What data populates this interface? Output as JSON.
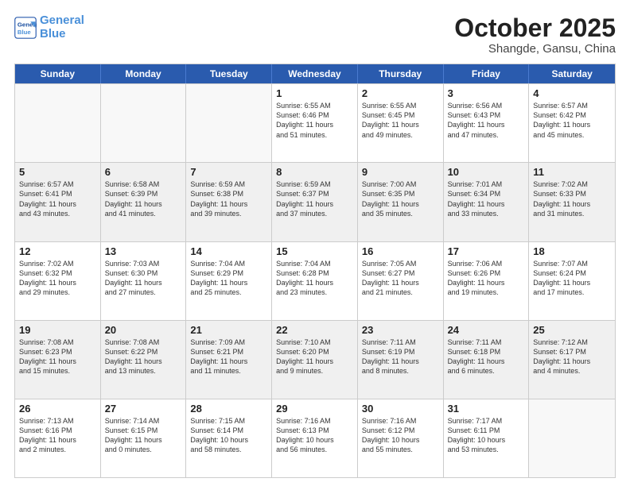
{
  "header": {
    "logo_line1": "General",
    "logo_line2": "Blue",
    "month": "October 2025",
    "location": "Shangde, Gansu, China"
  },
  "weekdays": [
    "Sunday",
    "Monday",
    "Tuesday",
    "Wednesday",
    "Thursday",
    "Friday",
    "Saturday"
  ],
  "rows": [
    [
      {
        "num": "",
        "lines": [],
        "empty": true
      },
      {
        "num": "",
        "lines": [],
        "empty": true
      },
      {
        "num": "",
        "lines": [],
        "empty": true
      },
      {
        "num": "1",
        "lines": [
          "Sunrise: 6:55 AM",
          "Sunset: 6:46 PM",
          "Daylight: 11 hours",
          "and 51 minutes."
        ],
        "empty": false
      },
      {
        "num": "2",
        "lines": [
          "Sunrise: 6:55 AM",
          "Sunset: 6:45 PM",
          "Daylight: 11 hours",
          "and 49 minutes."
        ],
        "empty": false
      },
      {
        "num": "3",
        "lines": [
          "Sunrise: 6:56 AM",
          "Sunset: 6:43 PM",
          "Daylight: 11 hours",
          "and 47 minutes."
        ],
        "empty": false
      },
      {
        "num": "4",
        "lines": [
          "Sunrise: 6:57 AM",
          "Sunset: 6:42 PM",
          "Daylight: 11 hours",
          "and 45 minutes."
        ],
        "empty": false
      }
    ],
    [
      {
        "num": "5",
        "lines": [
          "Sunrise: 6:57 AM",
          "Sunset: 6:41 PM",
          "Daylight: 11 hours",
          "and 43 minutes."
        ],
        "empty": false
      },
      {
        "num": "6",
        "lines": [
          "Sunrise: 6:58 AM",
          "Sunset: 6:39 PM",
          "Daylight: 11 hours",
          "and 41 minutes."
        ],
        "empty": false
      },
      {
        "num": "7",
        "lines": [
          "Sunrise: 6:59 AM",
          "Sunset: 6:38 PM",
          "Daylight: 11 hours",
          "and 39 minutes."
        ],
        "empty": false
      },
      {
        "num": "8",
        "lines": [
          "Sunrise: 6:59 AM",
          "Sunset: 6:37 PM",
          "Daylight: 11 hours",
          "and 37 minutes."
        ],
        "empty": false
      },
      {
        "num": "9",
        "lines": [
          "Sunrise: 7:00 AM",
          "Sunset: 6:35 PM",
          "Daylight: 11 hours",
          "and 35 minutes."
        ],
        "empty": false
      },
      {
        "num": "10",
        "lines": [
          "Sunrise: 7:01 AM",
          "Sunset: 6:34 PM",
          "Daylight: 11 hours",
          "and 33 minutes."
        ],
        "empty": false
      },
      {
        "num": "11",
        "lines": [
          "Sunrise: 7:02 AM",
          "Sunset: 6:33 PM",
          "Daylight: 11 hours",
          "and 31 minutes."
        ],
        "empty": false
      }
    ],
    [
      {
        "num": "12",
        "lines": [
          "Sunrise: 7:02 AM",
          "Sunset: 6:32 PM",
          "Daylight: 11 hours",
          "and 29 minutes."
        ],
        "empty": false
      },
      {
        "num": "13",
        "lines": [
          "Sunrise: 7:03 AM",
          "Sunset: 6:30 PM",
          "Daylight: 11 hours",
          "and 27 minutes."
        ],
        "empty": false
      },
      {
        "num": "14",
        "lines": [
          "Sunrise: 7:04 AM",
          "Sunset: 6:29 PM",
          "Daylight: 11 hours",
          "and 25 minutes."
        ],
        "empty": false
      },
      {
        "num": "15",
        "lines": [
          "Sunrise: 7:04 AM",
          "Sunset: 6:28 PM",
          "Daylight: 11 hours",
          "and 23 minutes."
        ],
        "empty": false
      },
      {
        "num": "16",
        "lines": [
          "Sunrise: 7:05 AM",
          "Sunset: 6:27 PM",
          "Daylight: 11 hours",
          "and 21 minutes."
        ],
        "empty": false
      },
      {
        "num": "17",
        "lines": [
          "Sunrise: 7:06 AM",
          "Sunset: 6:26 PM",
          "Daylight: 11 hours",
          "and 19 minutes."
        ],
        "empty": false
      },
      {
        "num": "18",
        "lines": [
          "Sunrise: 7:07 AM",
          "Sunset: 6:24 PM",
          "Daylight: 11 hours",
          "and 17 minutes."
        ],
        "empty": false
      }
    ],
    [
      {
        "num": "19",
        "lines": [
          "Sunrise: 7:08 AM",
          "Sunset: 6:23 PM",
          "Daylight: 11 hours",
          "and 15 minutes."
        ],
        "empty": false
      },
      {
        "num": "20",
        "lines": [
          "Sunrise: 7:08 AM",
          "Sunset: 6:22 PM",
          "Daylight: 11 hours",
          "and 13 minutes."
        ],
        "empty": false
      },
      {
        "num": "21",
        "lines": [
          "Sunrise: 7:09 AM",
          "Sunset: 6:21 PM",
          "Daylight: 11 hours",
          "and 11 minutes."
        ],
        "empty": false
      },
      {
        "num": "22",
        "lines": [
          "Sunrise: 7:10 AM",
          "Sunset: 6:20 PM",
          "Daylight: 11 hours",
          "and 9 minutes."
        ],
        "empty": false
      },
      {
        "num": "23",
        "lines": [
          "Sunrise: 7:11 AM",
          "Sunset: 6:19 PM",
          "Daylight: 11 hours",
          "and 8 minutes."
        ],
        "empty": false
      },
      {
        "num": "24",
        "lines": [
          "Sunrise: 7:11 AM",
          "Sunset: 6:18 PM",
          "Daylight: 11 hours",
          "and 6 minutes."
        ],
        "empty": false
      },
      {
        "num": "25",
        "lines": [
          "Sunrise: 7:12 AM",
          "Sunset: 6:17 PM",
          "Daylight: 11 hours",
          "and 4 minutes."
        ],
        "empty": false
      }
    ],
    [
      {
        "num": "26",
        "lines": [
          "Sunrise: 7:13 AM",
          "Sunset: 6:16 PM",
          "Daylight: 11 hours",
          "and 2 minutes."
        ],
        "empty": false
      },
      {
        "num": "27",
        "lines": [
          "Sunrise: 7:14 AM",
          "Sunset: 6:15 PM",
          "Daylight: 11 hours",
          "and 0 minutes."
        ],
        "empty": false
      },
      {
        "num": "28",
        "lines": [
          "Sunrise: 7:15 AM",
          "Sunset: 6:14 PM",
          "Daylight: 10 hours",
          "and 58 minutes."
        ],
        "empty": false
      },
      {
        "num": "29",
        "lines": [
          "Sunrise: 7:16 AM",
          "Sunset: 6:13 PM",
          "Daylight: 10 hours",
          "and 56 minutes."
        ],
        "empty": false
      },
      {
        "num": "30",
        "lines": [
          "Sunrise: 7:16 AM",
          "Sunset: 6:12 PM",
          "Daylight: 10 hours",
          "and 55 minutes."
        ],
        "empty": false
      },
      {
        "num": "31",
        "lines": [
          "Sunrise: 7:17 AM",
          "Sunset: 6:11 PM",
          "Daylight: 10 hours",
          "and 53 minutes."
        ],
        "empty": false
      },
      {
        "num": "",
        "lines": [],
        "empty": true
      }
    ]
  ]
}
